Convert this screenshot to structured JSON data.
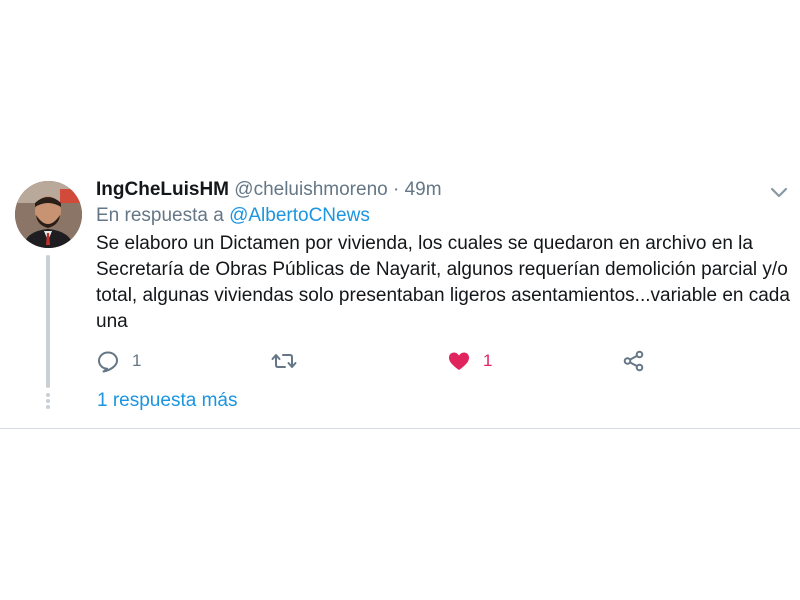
{
  "tweet": {
    "display_name": "IngCheLuisHM",
    "handle": "@cheluishmoreno",
    "separator": "·",
    "time": "49m",
    "reply_prefix": "En respuesta a",
    "reply_mention": "@AlbertoCNews",
    "text": "Se elaboro un Dictamen por vivienda, los cuales se quedaron en archivo en la Secretaría de Obras Públicas de Nayarit, algunos requerían demolición parcial y/o total, algunas viviendas solo presentaban ligeros asentamientos...variable en cada una",
    "actions": {
      "reply": {
        "icon": "reply-icon",
        "count": "1"
      },
      "retweet": {
        "icon": "retweet-icon"
      },
      "like": {
        "icon": "heart-icon",
        "count": "1",
        "color": "#e0245e"
      },
      "share": {
        "icon": "share-icon"
      }
    },
    "more_replies": "1 respuesta más"
  },
  "colors": {
    "link": "#1b95e0",
    "muted": "#657786",
    "like": "#e0245e",
    "thread_line": "#c8d0d6"
  }
}
